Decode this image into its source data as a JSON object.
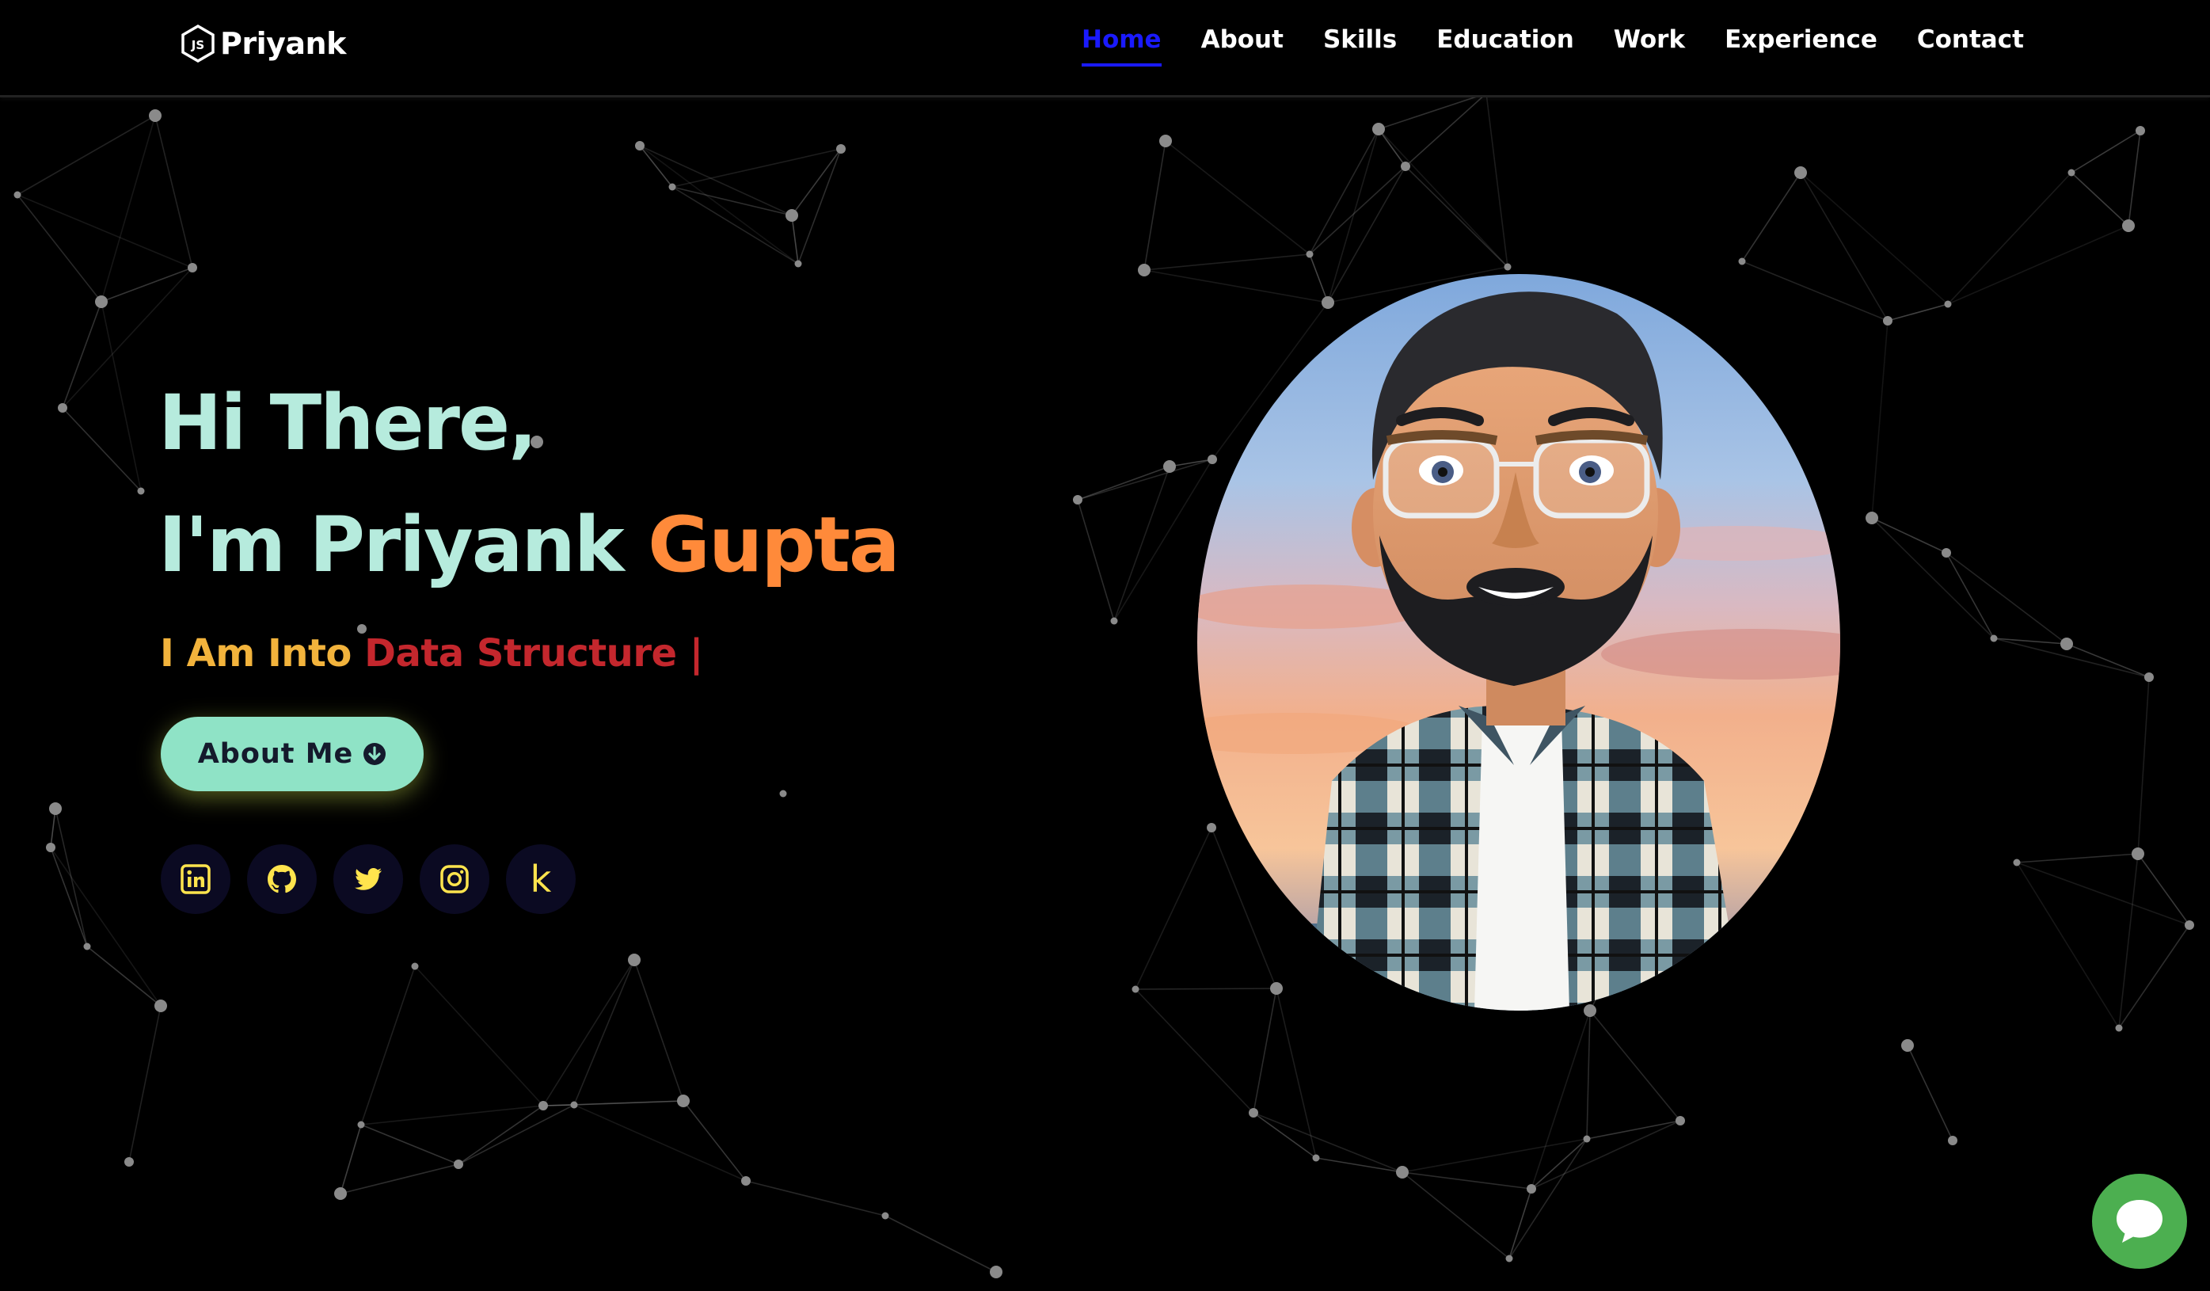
{
  "brand": {
    "name": "Priyank",
    "logo_icon": "nodejs-icon"
  },
  "nav": {
    "items": [
      {
        "label": "Home",
        "active": true
      },
      {
        "label": "About",
        "active": false
      },
      {
        "label": "Skills",
        "active": false
      },
      {
        "label": "Education",
        "active": false
      },
      {
        "label": "Work",
        "active": false
      },
      {
        "label": "Experience",
        "active": false
      },
      {
        "label": "Contact",
        "active": false
      }
    ],
    "active_color": "#1a1aff"
  },
  "hero": {
    "greeting": "Hi There,",
    "intro": "I'm Priyank",
    "last_name": "Gupta",
    "typed_prefix": "I Am Into",
    "typed_word": "Data Structure |",
    "button_label": "About Me",
    "button_icon": "arrow-down-circle-icon",
    "colors": {
      "heading": "#b6ebdd",
      "accent": "#ff8a3a",
      "prefix": "#f2b33c",
      "typed": "#c4272d",
      "button_bg": "#8fe3c6"
    }
  },
  "socials": [
    {
      "name": "linkedin",
      "icon": "linkedin-icon"
    },
    {
      "name": "github",
      "icon": "github-icon"
    },
    {
      "name": "twitter",
      "icon": "twitter-icon"
    },
    {
      "name": "instagram",
      "icon": "instagram-icon"
    },
    {
      "name": "kaggle",
      "icon": "kaggle-icon",
      "glyph": "k"
    }
  ],
  "avatar": {
    "icon": "avatar-image"
  },
  "chat": {
    "icon": "chat-bubble-icon",
    "color": "#4caf50"
  }
}
